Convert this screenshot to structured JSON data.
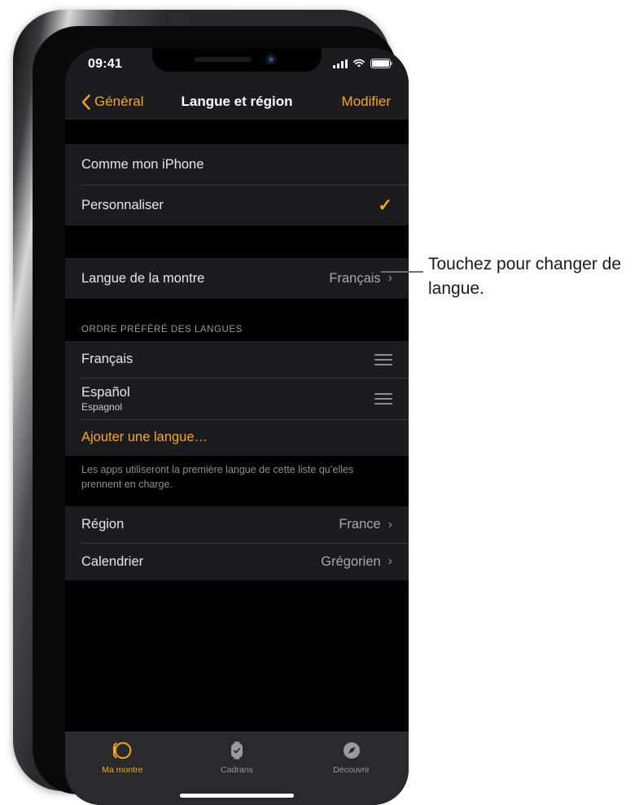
{
  "status_bar": {
    "time": "09:41",
    "cellular_icon": "signal-bars-icon",
    "wifi_icon": "wifi-icon",
    "battery_icon": "battery-full-icon"
  },
  "nav_bar": {
    "back_icon": "chevron-left-icon",
    "back_label": "Général",
    "title": "Langue et région",
    "action_label": "Modifier"
  },
  "groups": {
    "sync_group": {
      "rows": [
        {
          "label": "Comme mon iPhone",
          "accessory": "none"
        },
        {
          "label": "Personnaliser",
          "accessory": "checkmark"
        }
      ]
    },
    "watch_language_group": {
      "rows": [
        {
          "label": "Langue de la montre",
          "value": "Français",
          "accessory": "chevron"
        }
      ]
    },
    "language_order": {
      "header": "ORDRE PRÉFÉRÉ DES LANGUES",
      "rows": [
        {
          "label": "Français",
          "sub": "",
          "accessory": "reorder"
        },
        {
          "label": "Español",
          "sub": "Espagnol",
          "accessory": "reorder"
        }
      ],
      "add_label": "Ajouter une langue…",
      "footer": "Les apps utiliseront la première langue de cette liste qu’elles prennent en charge."
    },
    "region_group": {
      "rows": [
        {
          "label": "Région",
          "value": "France",
          "accessory": "chevron"
        },
        {
          "label": "Calendrier",
          "value": "Grégorien",
          "accessory": "chevron"
        }
      ]
    }
  },
  "tab_bar": {
    "tabs": [
      {
        "label": "Ma montre",
        "icon": "watch-icon",
        "active": true
      },
      {
        "label": "Cadrans",
        "icon": "watch-face-icon",
        "active": false
      },
      {
        "label": "Découvrir",
        "icon": "compass-icon",
        "active": false
      }
    ]
  },
  "callout": {
    "text": "Touchez pour changer de langue."
  },
  "colors": {
    "accent": "#f5a623",
    "row_background": "#1c1c1e",
    "screen_background": "#000000",
    "separator": "#3a3a3c",
    "secondary_text": "#8e8e93"
  }
}
